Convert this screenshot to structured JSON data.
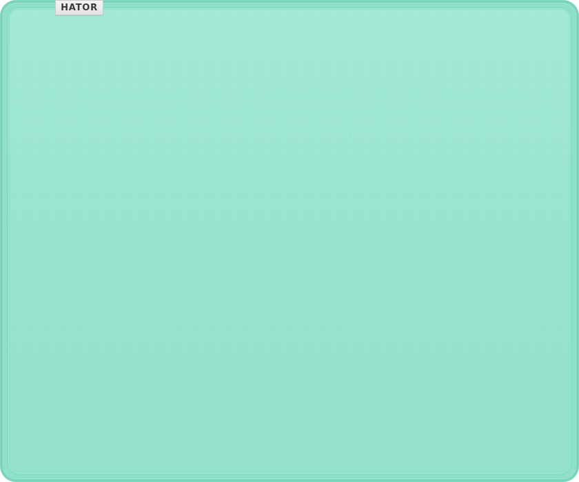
{
  "product": {
    "brand_label": "HATOR",
    "pad_color": "#98e4cf",
    "edge_color": "#7ad3bc",
    "tag_color": "#ececec"
  }
}
